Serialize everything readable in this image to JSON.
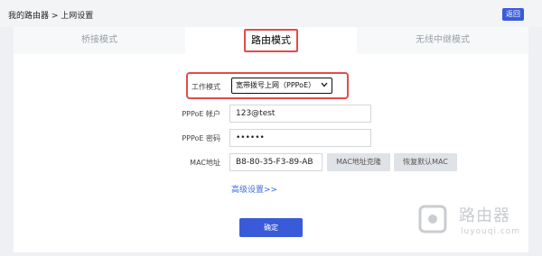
{
  "header": {
    "breadcrumb": "我的路由器 > 上网设置",
    "back_label": "返回"
  },
  "tabs": [
    {
      "label": "桥接模式",
      "active": false
    },
    {
      "label": "路由模式",
      "active": true
    },
    {
      "label": "无线中继模式",
      "active": false
    }
  ],
  "form": {
    "work_mode_label": "工作模式",
    "work_mode_value": "宽带拨号上网（PPPoE）",
    "pppoe_account_label": "PPPoE 帐户",
    "pppoe_account_value": "123@test",
    "pppoe_password_label": "PPPoE 密码",
    "pppoe_password_value": "••••••",
    "mac_label": "MAC地址",
    "mac_value": "B8-80-35-F3-89-AB",
    "mac_clone_label": "MAC地址克隆",
    "mac_restore_label": "恢复默认MAC",
    "advanced_link": "高级设置>>",
    "confirm_label": "确定"
  },
  "watermark": {
    "title": "路由器",
    "url": "luyouqi.com"
  },
  "colors": {
    "accent": "#3a5bd9",
    "highlight": "#e44b4b"
  }
}
